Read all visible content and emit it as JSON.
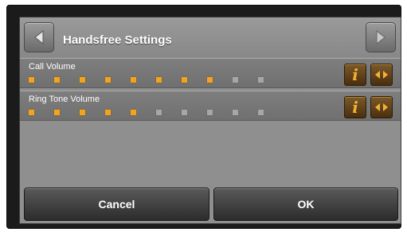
{
  "header": {
    "title": "Handsfree Settings",
    "back_icon": "arrow-left-icon",
    "forward_icon": "arrow-right-icon"
  },
  "settings": [
    {
      "label": "Call Volume",
      "level": 8,
      "max": 10
    },
    {
      "label": "Ring Tone Volume",
      "level": 5,
      "max": 10
    }
  ],
  "buttons": {
    "cancel_label": "Cancel",
    "ok_label": "OK"
  },
  "colors": {
    "accent": "#f4a41a",
    "inactive_dot": "#a7a7a7"
  }
}
